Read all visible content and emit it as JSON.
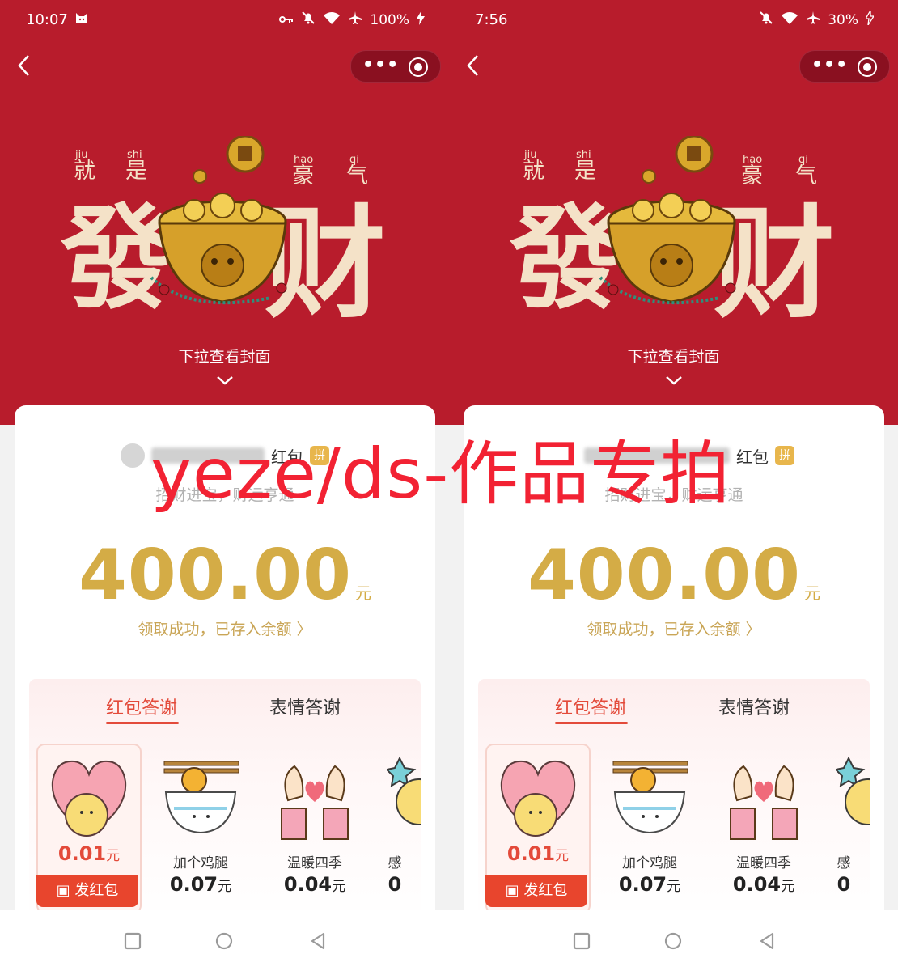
{
  "screens": [
    {
      "status_time": "10:07",
      "battery": "100%",
      "pull_hint": "下拉查看封面",
      "sender_suffix": "红包",
      "pin_badge": "拼",
      "blessing": "招财进宝，财运亨通",
      "amount": "400.00",
      "amount_unit": "元",
      "received_text": "领取成功，已存入余额 〉",
      "tabs": [
        "红包答谢",
        "表情答谢"
      ],
      "gifts": [
        {
          "name": "",
          "price": "0.01",
          "unit": "元",
          "icon": "heart-hug-icon"
        },
        {
          "name": "加个鸡腿",
          "price": "0.07",
          "unit": "元",
          "icon": "rice-bowl-drumstick-icon"
        },
        {
          "name": "温暖四季",
          "price": "0.04",
          "unit": "元",
          "icon": "hands-heart-icon"
        },
        {
          "name": "感",
          "price": "0",
          "unit": "",
          "icon": "star-moon-icon"
        }
      ],
      "send_button": "发红包"
    },
    {
      "status_time": "7:56",
      "battery": "30%",
      "pull_hint": "下拉查看封面",
      "sender_suffix": "红包",
      "pin_badge": "拼",
      "blessing": "招财进宝，财运亨通",
      "amount": "400.00",
      "amount_unit": "元",
      "received_text": "领取成功，已存入余额 〉",
      "tabs": [
        "红包答谢",
        "表情答谢"
      ],
      "gifts": [
        {
          "name": "",
          "price": "0.01",
          "unit": "元",
          "icon": "heart-hug-icon"
        },
        {
          "name": "加个鸡腿",
          "price": "0.07",
          "unit": "元",
          "icon": "rice-bowl-drumstick-icon"
        },
        {
          "name": "温暖四季",
          "price": "0.04",
          "unit": "元",
          "icon": "hands-heart-icon"
        },
        {
          "name": "感",
          "price": "0",
          "unit": "",
          "icon": "star-moon-icon"
        }
      ],
      "send_button": "发红包"
    }
  ],
  "cover": {
    "pinyin": [
      "jiu",
      "shi",
      "hao",
      "qi"
    ],
    "small_chars": [
      "就",
      "是",
      "豪",
      "气"
    ],
    "big_chars": [
      "發",
      "财"
    ]
  },
  "watermark": "yeze/ds-作品专拍",
  "colors": {
    "hero_red": "#b81c2c",
    "amount_gold": "#d4ac46",
    "accent_red": "#e34a3a",
    "watermark_red": "#f22233"
  }
}
